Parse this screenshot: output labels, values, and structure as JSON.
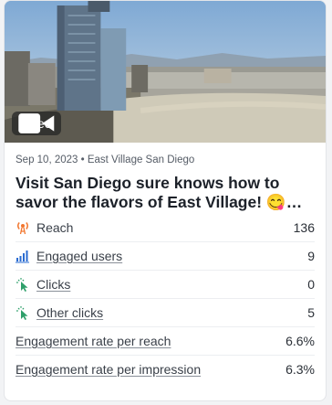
{
  "post": {
    "media_type_label": "Video",
    "meta": "Sep 10, 2023 • East Village San Diego",
    "title": "Visit San Diego sure knows how to savor the flavors of East Village! 😋…",
    "colors": {
      "accent_orange": "#f2762e",
      "accent_blue": "#2a6bd1",
      "accent_green": "#2e9f6a"
    }
  },
  "metrics": [
    {
      "label": "Reach",
      "value": "136",
      "icon": "broadcast-icon",
      "link": false
    },
    {
      "label": "Engaged users",
      "value": "9",
      "icon": "bar-chart-icon",
      "link": true
    },
    {
      "label": "Clicks",
      "value": "0",
      "icon": "cursor-click-icon",
      "link": true
    },
    {
      "label": "Other clicks",
      "value": "5",
      "icon": "cursor-click-icon",
      "link": true
    },
    {
      "label": "Engagement rate per reach",
      "value": "6.6%",
      "icon": "",
      "link": true
    },
    {
      "label": "Engagement rate per impression",
      "value": "6.3%",
      "icon": "",
      "link": true
    }
  ]
}
